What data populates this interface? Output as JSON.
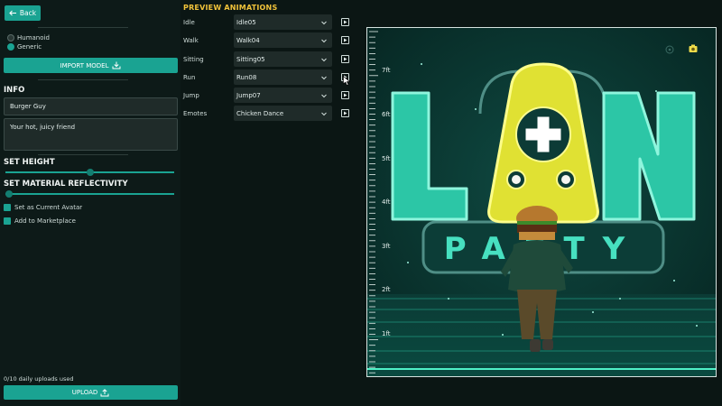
{
  "nav": {
    "back_label": "Back"
  },
  "body_type": {
    "options": [
      {
        "label": "Humanoid",
        "selected": false
      },
      {
        "label": "Generic",
        "selected": true
      }
    ]
  },
  "import_label": "IMPORT MODEL",
  "info": {
    "title": "INFO",
    "name": "Burger Guy",
    "description": "Your hot, juicy friend"
  },
  "height": {
    "title": "SET HEIGHT",
    "value_fraction": 0.5
  },
  "reflectivity": {
    "title": "SET MATERIAL REFLECTIVITY",
    "value_fraction": 0.0
  },
  "checks": [
    {
      "label": "Set as Current Avatar",
      "checked": true
    },
    {
      "label": "Add to Marketplace",
      "checked": true
    }
  ],
  "uploads": {
    "status": "0/10 daily uploads used",
    "button_label": "UPLOAD"
  },
  "animations": {
    "title": "PREVIEW ANIMATIONS",
    "rows": [
      {
        "label": "Idle",
        "value": "Idle05"
      },
      {
        "label": "Walk",
        "value": "Walk04"
      },
      {
        "label": "Sitting",
        "value": "Sitting05"
      },
      {
        "label": "Run",
        "value": "Run08"
      },
      {
        "label": "Jump",
        "value": "Jump07"
      },
      {
        "label": "Emotes",
        "value": "Chicken Dance"
      }
    ]
  },
  "ruler": {
    "labels": [
      "7ft",
      "6ft",
      "5ft",
      "4ft",
      "3ft",
      "2ft",
      "1ft"
    ]
  },
  "scene": {
    "logo_top": "LAN",
    "logo_bottom": "PARTY"
  },
  "colors": {
    "accent": "#1aa392",
    "title_yellow": "#f2c33a",
    "logo_green": "#3fe3c1",
    "logo_yellow": "#e8e63a"
  }
}
